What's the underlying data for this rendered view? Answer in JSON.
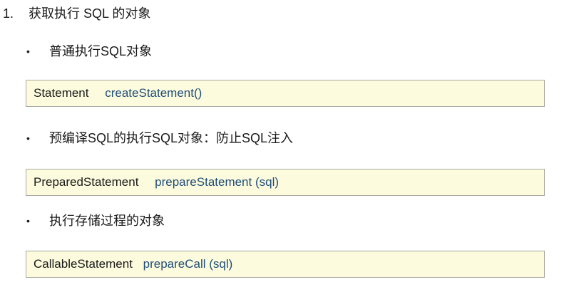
{
  "heading": {
    "number": "1.",
    "text": "获取执行 SQL 的对象"
  },
  "items": [
    {
      "bullet": "•",
      "label": "普通执行SQL对象",
      "code_type": "Statement",
      "code_method": "createStatement()"
    },
    {
      "bullet": "•",
      "label": "预编译SQL的执行SQL对象：防止SQL注入",
      "code_type": "PreparedStatement",
      "code_method": "prepareStatement (sql)"
    },
    {
      "bullet": "•",
      "label": "执行存储过程的对象",
      "code_type": "CallableStatement",
      "code_method": "prepareCall (sql)"
    }
  ]
}
